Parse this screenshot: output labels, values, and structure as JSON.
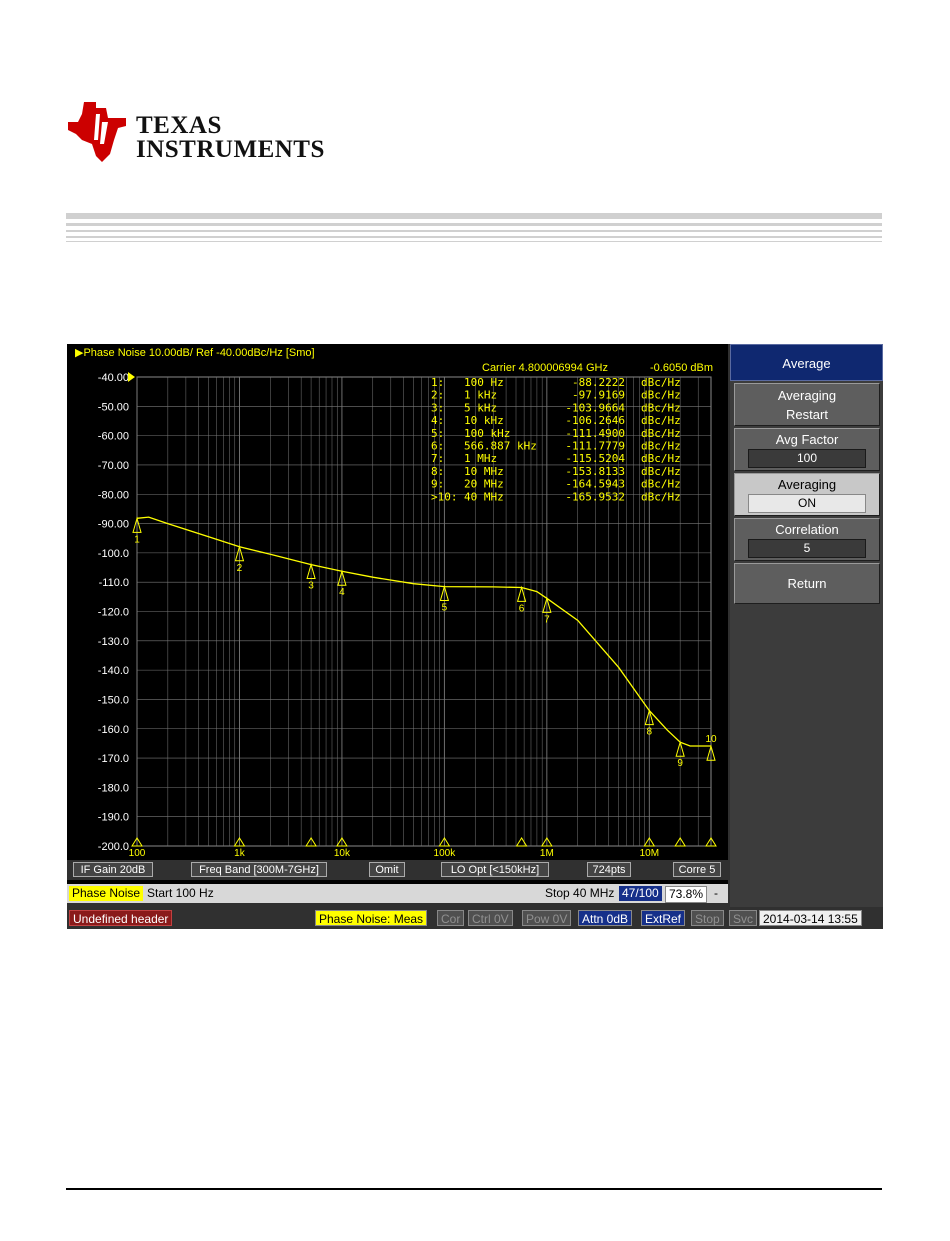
{
  "brand": {
    "line1": "Texas",
    "line2": "Instruments"
  },
  "window": {
    "title": "Phase Noise 10.00dB/ Ref -40.00dBc/Hz [Smo]"
  },
  "carrier": {
    "label": "Carrier 4.800006994 GHz",
    "power": "-0.6050 dBm"
  },
  "markers": [
    {
      "id": "1:",
      "freq": "100  Hz",
      "value": "-88.2222",
      "unit": "dBc/Hz"
    },
    {
      "id": "2:",
      "freq": "1  kHz",
      "value": "-97.9169",
      "unit": "dBc/Hz"
    },
    {
      "id": "3:",
      "freq": "5  kHz",
      "value": "-103.9664",
      "unit": "dBc/Hz"
    },
    {
      "id": "4:",
      "freq": "10  kHz",
      "value": "-106.2646",
      "unit": "dBc/Hz"
    },
    {
      "id": "5:",
      "freq": "100  kHz",
      "value": "-111.4900",
      "unit": "dBc/Hz"
    },
    {
      "id": "6:",
      "freq": "566.887  kHz",
      "value": "-111.7779",
      "unit": "dBc/Hz"
    },
    {
      "id": "7:",
      "freq": "1  MHz",
      "value": "-115.5204",
      "unit": "dBc/Hz"
    },
    {
      "id": "8:",
      "freq": "10  MHz",
      "value": "-153.8133",
      "unit": "dBc/Hz"
    },
    {
      "id": "9:",
      "freq": "20  MHz",
      "value": "-164.5943",
      "unit": "dBc/Hz"
    },
    {
      "id": ">10:",
      "freq": "40  MHz",
      "value": "-165.9532",
      "unit": "dBc/Hz"
    }
  ],
  "y_axis": {
    "ticks": [
      "-40.00",
      "-50.00",
      "-60.00",
      "-70.00",
      "-80.00",
      "-90.00",
      "-100.0",
      "-110.0",
      "-120.0",
      "-130.0",
      "-140.0",
      "-150.0",
      "-160.0",
      "-170.0",
      "-180.0",
      "-190.0",
      "-200.0"
    ]
  },
  "x_axis": {
    "labels": [
      "100",
      "1k",
      "10k",
      "100k",
      "1M",
      "10M"
    ]
  },
  "trace": {
    "points": [
      [
        100,
        -88.2
      ],
      [
        130,
        -87.8
      ],
      [
        200,
        -90.0
      ],
      [
        500,
        -94.5
      ],
      [
        1000,
        -97.9
      ],
      [
        2000,
        -100.5
      ],
      [
        5000,
        -104.0
      ],
      [
        10000,
        -106.3
      ],
      [
        20000,
        -108.3
      ],
      [
        50000,
        -110.5
      ],
      [
        100000,
        -111.5
      ],
      [
        300000,
        -111.6
      ],
      [
        566887,
        -111.8
      ],
      [
        800000,
        -113.2
      ],
      [
        1000000,
        -115.5
      ],
      [
        2000000,
        -123.0
      ],
      [
        5000000,
        -139.0
      ],
      [
        10000000,
        -153.8
      ],
      [
        15000000,
        -160.5
      ],
      [
        20000000,
        -164.6
      ],
      [
        25000000,
        -165.9
      ],
      [
        40000000,
        -165.9
      ]
    ]
  },
  "control_bar": {
    "if_gain": "IF Gain 20dB",
    "freq_band": "Freq Band [300M-7GHz]",
    "omit": "Omit",
    "lo_opt": "LO Opt [<150kHz]",
    "points": "724pts",
    "corre": "Corre 5"
  },
  "sweep_bar": {
    "mode": "Phase Noise",
    "start": "Start 100 Hz",
    "stop": "Stop 40 MHz",
    "count": "47/100",
    "percent": "73.8%",
    "dash": "-"
  },
  "status_bar": {
    "header": "Undefined header",
    "meas": "Phase Noise: Meas",
    "cor": "Cor",
    "ctrl": "Ctrl  0V",
    "pow": "Pow  0V",
    "attn": "Attn 0dB",
    "extref": "ExtRef",
    "stop": "Stop",
    "svc": "Svc",
    "datetime": "2014-03-14 13:55"
  },
  "softkeys": {
    "title": "Average",
    "restart_1": "Averaging",
    "restart_2": "Restart",
    "avg_factor": "Avg Factor",
    "avg_factor_value": "100",
    "averaging": "Averaging",
    "averaging_value": "ON",
    "correlation": "Correlation",
    "correlation_value": "5",
    "return": "Return"
  },
  "colors": {
    "trace": "#ffff00",
    "plot_bg": "#000000",
    "grid": "#7a7a7a",
    "ti_red": "#cc0000"
  }
}
